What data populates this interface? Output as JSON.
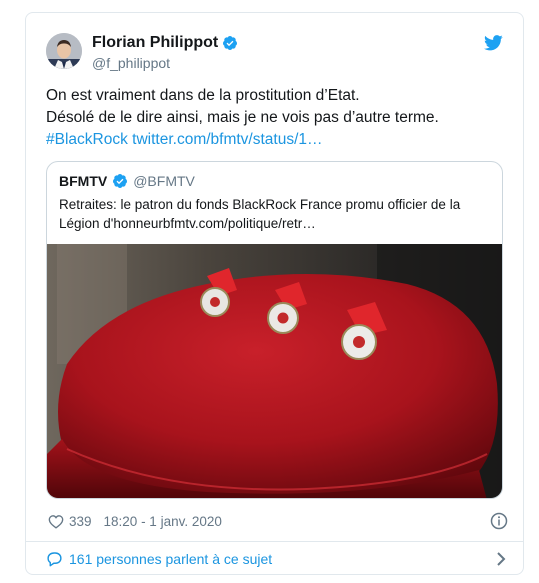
{
  "tweet": {
    "author_name": "Florian Philippot",
    "author_handle": "@f_philippot",
    "text_lines": [
      "On est vraiment dans de la prostitution d’Etat.",
      "Désolé de le dire ainsi, mais je ne vois pas d’autre terme."
    ],
    "hashtag": "#BlackRock",
    "link": "twitter.com/bfmtv/status/1…",
    "icons": {
      "verified": "verified-badge-icon",
      "brand": "twitter-bird-icon"
    }
  },
  "quote": {
    "author_name": "BFMTV",
    "author_handle": "@BFMTV",
    "text_lines": [
      "Retraites: le patron du fonds BlackRock France promu officier de la",
      "Légion d'honneurbfmtv.com/politique/retr…"
    ],
    "image": {
      "description_icon": "medals-on-red-cushion-photo"
    }
  },
  "meta": {
    "likes": "339",
    "time": "18:20 - 1 janv. 2020"
  },
  "conversation": {
    "label": "161 personnes parlent à ce sujet"
  },
  "colors": {
    "accent": "#1b95e0",
    "muted": "#657786",
    "border": "#e1e8ed",
    "cushion": "#b0141c"
  }
}
